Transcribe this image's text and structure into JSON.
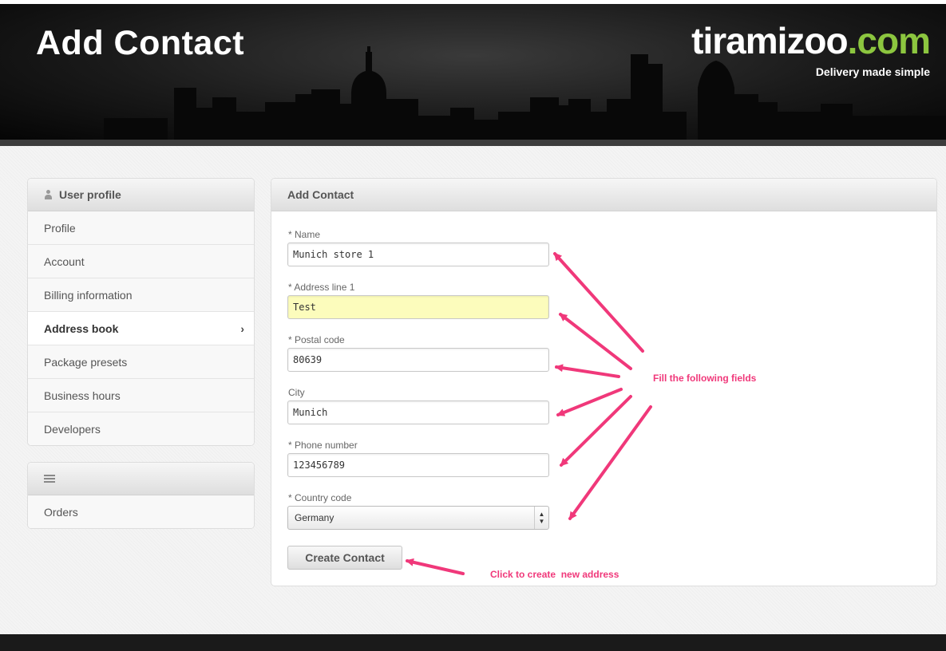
{
  "header": {
    "title": "Add Contact",
    "brand_white": "tiramizoo",
    "brand_green": ".com",
    "tagline": "Delivery made simple"
  },
  "sidebar": {
    "profile_panel": {
      "heading": "User profile",
      "heading_icon": "user-icon",
      "items": [
        {
          "label": "Profile"
        },
        {
          "label": "Account"
        },
        {
          "label": "Billing information"
        },
        {
          "label": "Address book",
          "active": true
        },
        {
          "label": "Package presets"
        },
        {
          "label": "Business hours"
        },
        {
          "label": "Developers"
        }
      ],
      "active_indicator": "›"
    },
    "orders_panel": {
      "heading_icon": "list-icon",
      "items": [
        {
          "label": "Orders"
        }
      ]
    }
  },
  "form": {
    "heading": "Add Contact",
    "fields": [
      {
        "label": "* Name",
        "value": "Munich store 1"
      },
      {
        "label": "* Address line 1",
        "value": "Test"
      },
      {
        "label": "* Postal code",
        "value": "80639"
      },
      {
        "label": "City",
        "value": "Munich"
      },
      {
        "label": "* Phone number",
        "value": "123456789"
      }
    ],
    "country": {
      "label": "* Country code",
      "selected": "Germany"
    },
    "submit_label": "Create Contact"
  },
  "annotations": {
    "fields_note": "Fill the following fields",
    "button_note": "Click to create  new address",
    "color": "#f0387a"
  }
}
